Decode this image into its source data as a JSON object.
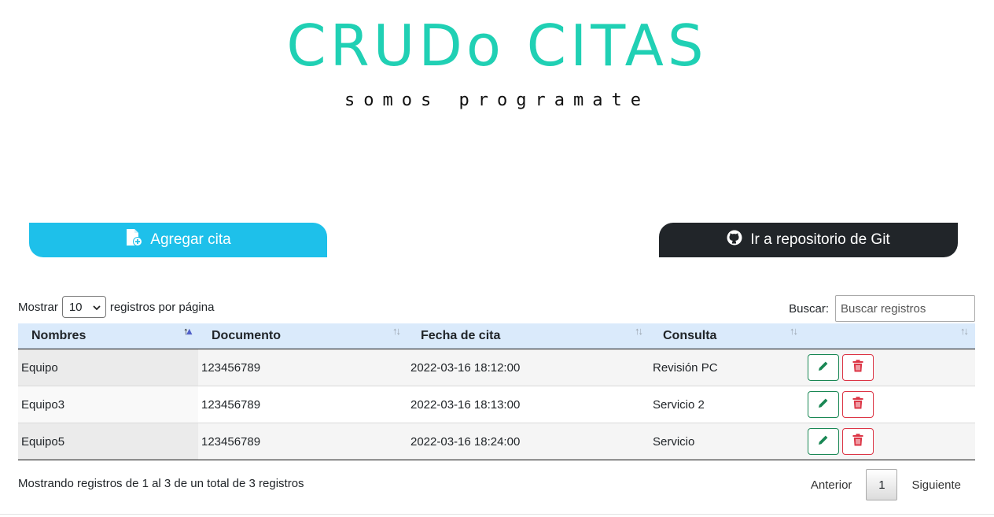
{
  "header": {
    "title": "CRUDo CITAS",
    "subtitle": "somos programate"
  },
  "actions": {
    "add_label": "Agregar cita",
    "git_label": "Ir a repositorio de Git",
    "add_color": "#1ec0ea",
    "git_color": "#212529"
  },
  "length_control": {
    "prefix": "Mostrar",
    "selected": "10",
    "suffix": "registros por página"
  },
  "search": {
    "label": "Buscar:",
    "placeholder": "Buscar registros"
  },
  "table": {
    "columns": [
      "Nombres",
      "Documento",
      "Fecha de cita",
      "Consulta",
      ""
    ],
    "rows": [
      {
        "nombres": "Equipo",
        "documento": "123456789",
        "fecha": "2022-03-16 18:12:00",
        "consulta": "Revisión PC"
      },
      {
        "nombres": "Equipo3",
        "documento": "123456789",
        "fecha": "2022-03-16 18:13:00",
        "consulta": "Servicio 2"
      },
      {
        "nombres": "Equipo5",
        "documento": "123456789",
        "fecha": "2022-03-16 18:24:00",
        "consulta": "Servicio"
      }
    ],
    "row_actions": [
      "pencil-icon",
      "trash-icon"
    ]
  },
  "footer": {
    "info": "Mostrando registros de 1 al 3 de un total de 3 registros",
    "prev": "Anterior",
    "page": "1",
    "next": "Siguiente"
  },
  "colors": {
    "title": "#20d0b4",
    "header_row": "#daeafb",
    "edit": "#198754",
    "delete": "#dc3545"
  }
}
